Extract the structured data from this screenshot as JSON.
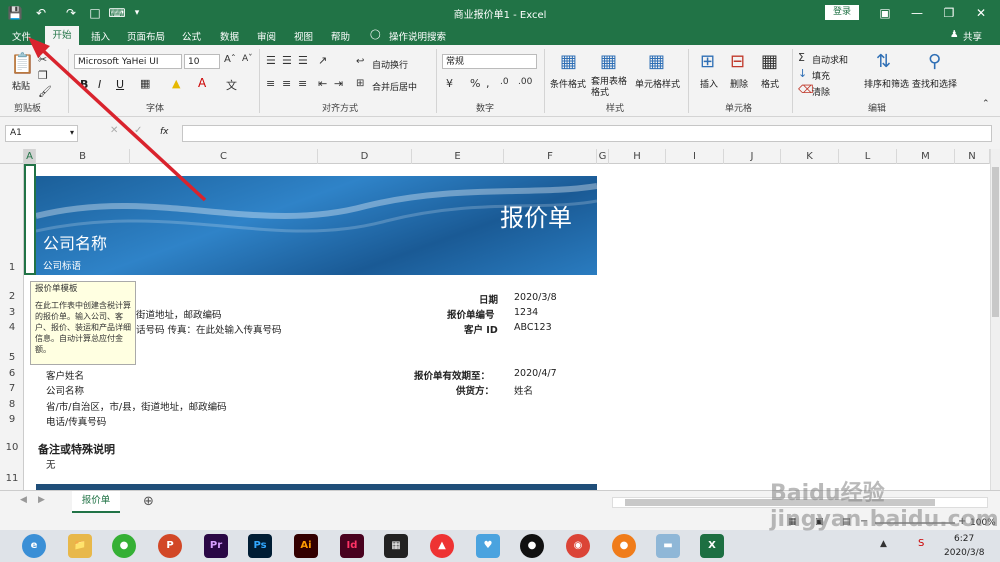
{
  "titlebar": {
    "title": "商业报价单1 - Excel",
    "login": "登录"
  },
  "menubar": {
    "tabs": [
      "文件",
      "开始",
      "插入",
      "页面布局",
      "公式",
      "数据",
      "审阅",
      "视图",
      "帮助"
    ],
    "search": "操作说明搜索",
    "share": "共享"
  },
  "ribbon": {
    "clipboard": {
      "paste": "粘贴",
      "group": "剪贴板"
    },
    "font": {
      "name": "Microsoft YaHei UI",
      "size": "10",
      "group": "字体",
      "bold": "B",
      "italic": "I",
      "underline": "U"
    },
    "alignment": {
      "wrap": "自动换行",
      "merge": "合并后居中",
      "group": "对齐方式"
    },
    "number": {
      "format": "常规",
      "group": "数字"
    },
    "styles": {
      "conditional": "条件格式",
      "table": "套用表格格式",
      "cell": "单元格样式",
      "group": "样式"
    },
    "cells": {
      "insert": "插入",
      "delete": "删除",
      "format": "格式",
      "group": "单元格"
    },
    "editing": {
      "autosum": "自动求和",
      "fill": "填充",
      "clear": "清除",
      "sort": "排序和筛选",
      "find": "查找和选择",
      "group": "编辑"
    }
  },
  "formula_bar": {
    "namebox": "A1",
    "fx": "fx",
    "value": ""
  },
  "columns": [
    "A",
    "B",
    "C",
    "D",
    "E",
    "F",
    "G",
    "H",
    "I",
    "J",
    "K",
    "L",
    "M",
    "N"
  ],
  "rows": [
    "1",
    "2",
    "3",
    "4",
    "5",
    "6",
    "7",
    "8",
    "9",
    "10",
    "11"
  ],
  "sheet": {
    "banner_title": "报价单",
    "company_name": "公司名称",
    "company_slogan": "公司标语",
    "address": "街道地址，邮政编码",
    "phone_line": "话号码    传真：在此处输入传真号码",
    "date_label": "日期",
    "date_value": "2020/3/8",
    "quote_no_label": "报价单编号",
    "quote_no_value": "1234",
    "customer_id_label": "客户 ID",
    "customer_id_value": "ABC123",
    "customer_name": "客户姓名",
    "customer_company": "公司名称",
    "customer_address": "省/市/自治区，市/县，街道地址，邮政编码",
    "customer_phone": "电话/传真号码",
    "valid_label": "报价单有效期至：",
    "valid_value": "2020/4/7",
    "supplier_label": "供货方：",
    "supplier_value": "姓名",
    "notes_title": "备注或特殊说明",
    "notes_value": "无"
  },
  "tooltip": {
    "title": "报价单模板",
    "body": "在此工作表中创建含税计算的报价单。输入公司、客户、报价、装运和产品详细信息。自动计算总应付金额。"
  },
  "sheet_tabs": {
    "active": "报价单"
  },
  "statusbar": {
    "zoom": "100%"
  },
  "taskbar": {
    "time": "6:27",
    "date": "2020/3/8"
  },
  "watermark": "Baidu经验 jingyan.baidu.com"
}
